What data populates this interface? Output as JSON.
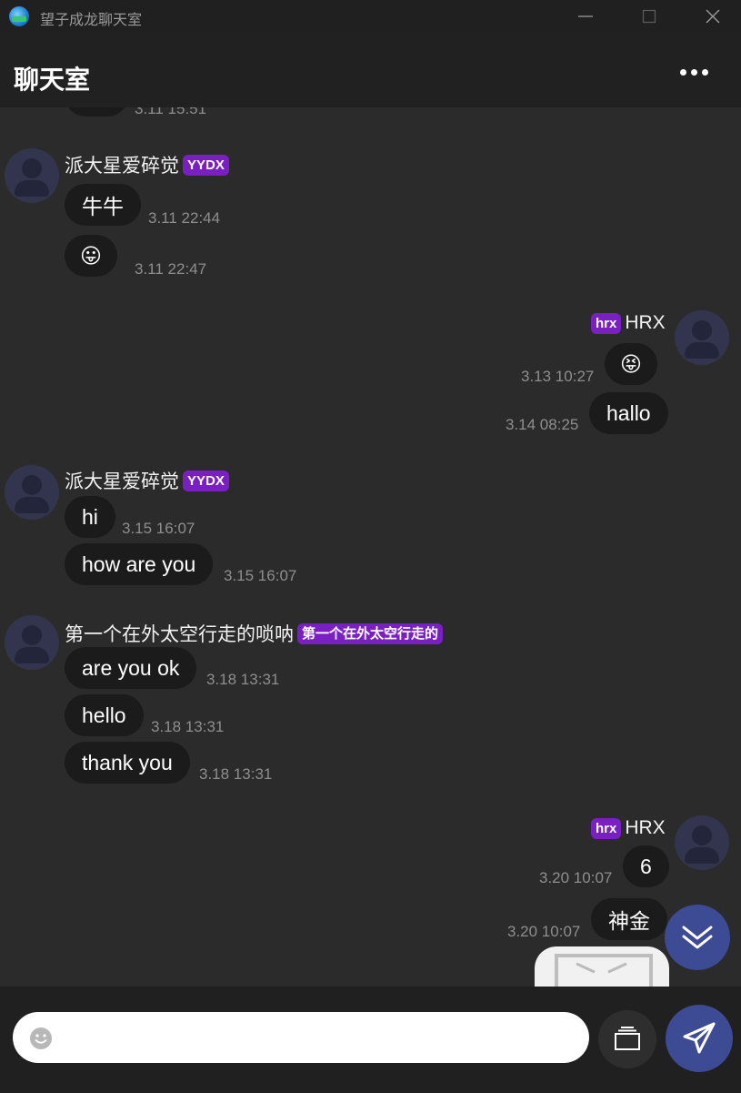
{
  "window": {
    "title": "望子成龙聊天室"
  },
  "header": {
    "title": "聊天室"
  },
  "messages": {
    "m0_time": "3.11 15:51",
    "g1": {
      "name": "派大星爱碎觉",
      "badge": "YYDX",
      "m1": {
        "text": "牛牛",
        "time": "3.11 22:44"
      },
      "m2": {
        "emoji": "😛",
        "time": "3.11 22:47"
      }
    },
    "g2": {
      "name": "HRX",
      "badge": "hrx",
      "m1": {
        "emoji": "😝",
        "time": "3.13 10:27"
      },
      "m2": {
        "text": "hallo",
        "time": "3.14 08:25"
      }
    },
    "g3": {
      "name": "派大星爱碎觉",
      "badge": "YYDX",
      "m1": {
        "text": "hi",
        "time": "3.15 16:07"
      },
      "m2": {
        "text": "how are you",
        "time": "3.15 16:07"
      }
    },
    "g4": {
      "name": "第一个在外太空行走的唢呐",
      "badge": "第一个在外太空行走的",
      "m1": {
        "text": "are you ok",
        "time": "3.18 13:31"
      },
      "m2": {
        "text": "hello",
        "time": "3.18 13:31"
      },
      "m3": {
        "text": "thank you",
        "time": "3.18 13:31"
      }
    },
    "g5": {
      "name": "HRX",
      "badge": "hrx",
      "m1": {
        "text": "6",
        "time": "3.20 10:07"
      },
      "m2": {
        "text": "神金",
        "time": "3.20 10:07"
      }
    }
  },
  "composer": {
    "placeholder": "",
    "value": ""
  },
  "colors": {
    "accent": "#3d4a94",
    "badge": "#7a1fc2",
    "bubble": "#1b1b1b",
    "background": "#2b2b2b"
  },
  "icons": [
    "app-icon",
    "minimize-icon",
    "maximize-icon",
    "close-icon",
    "more-icon",
    "user-avatar-icon",
    "scroll-down-icon",
    "emoji-icon",
    "folder-icon",
    "send-icon"
  ]
}
